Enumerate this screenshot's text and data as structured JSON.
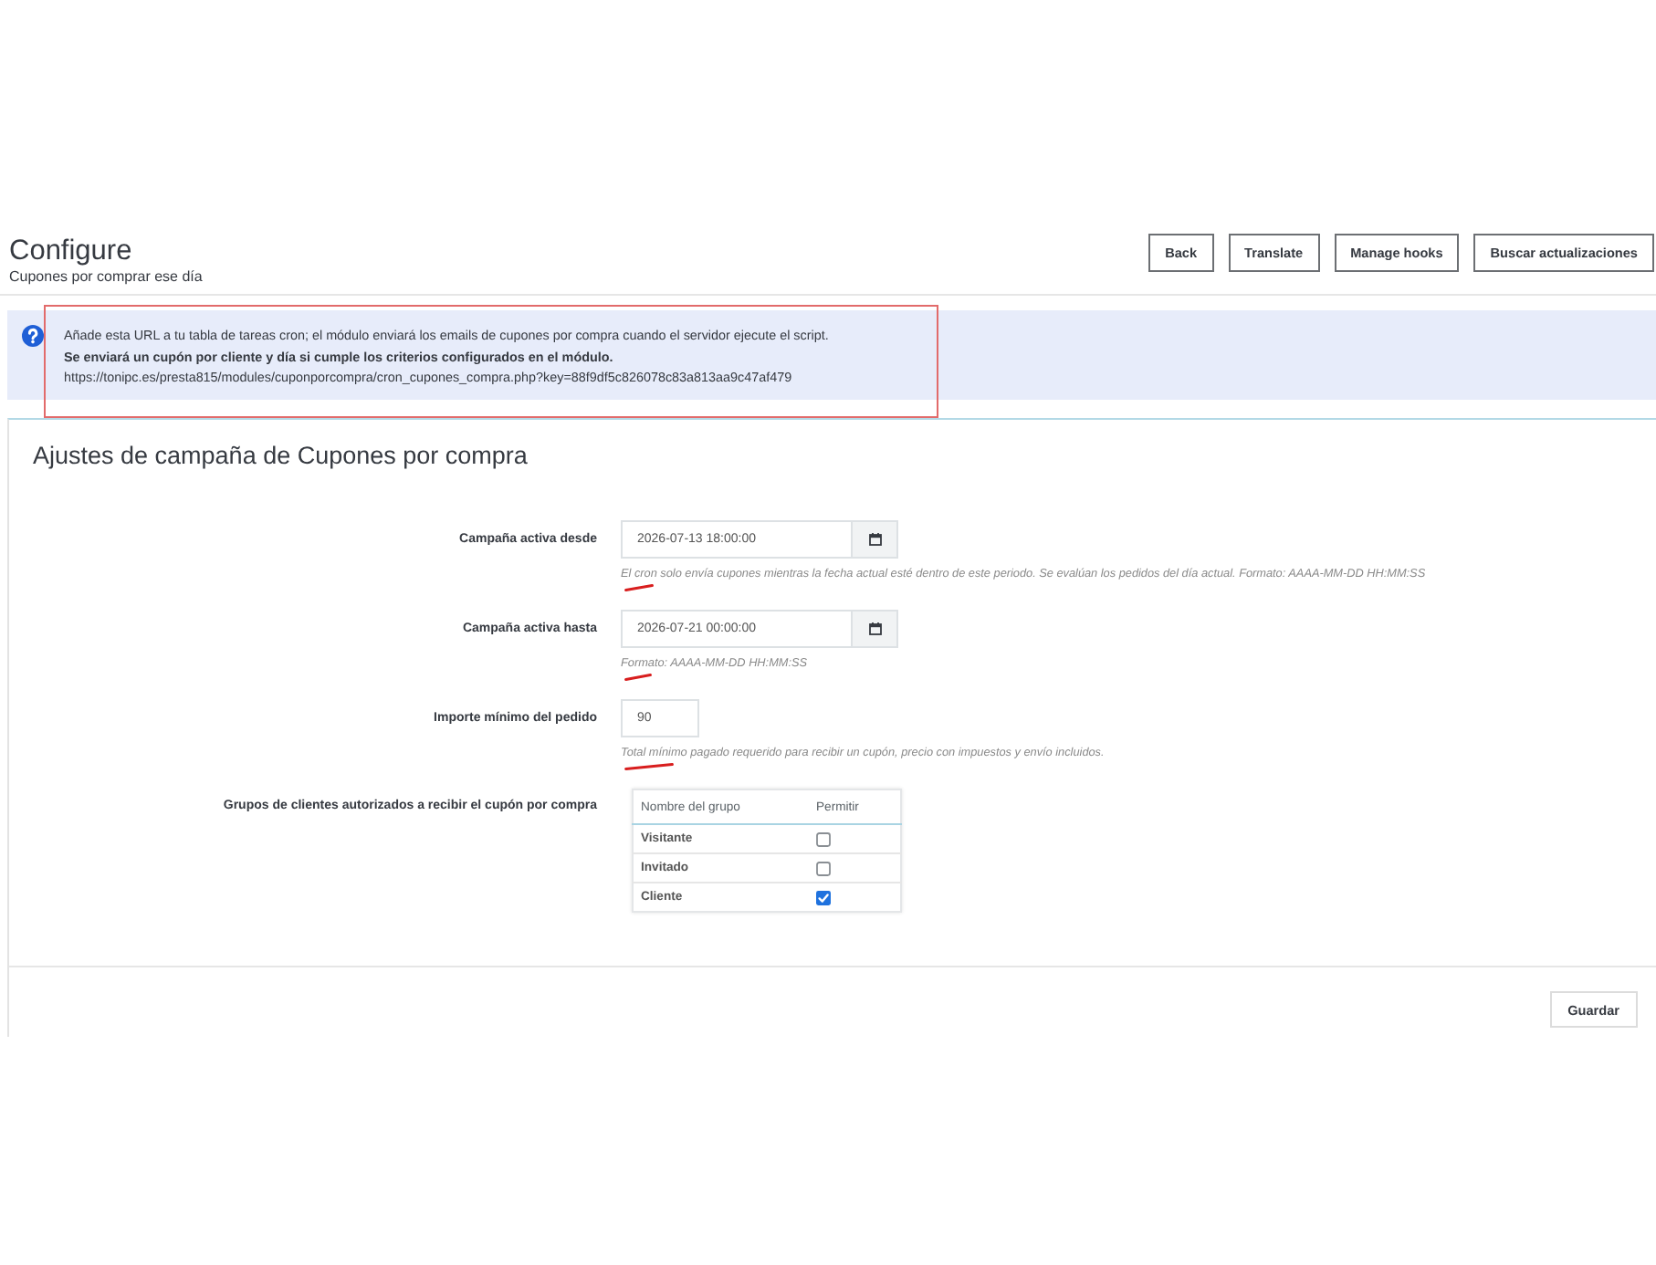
{
  "header": {
    "title": "Configure",
    "subtitle": "Cupones por comprar ese día",
    "buttons": [
      "Back",
      "Translate",
      "Manage hooks",
      "Buscar actualizaciones"
    ]
  },
  "alert": {
    "annotated": true,
    "lines": [
      {
        "kind": "text",
        "text": "Añade esta URL a tu tabla de tareas cron; el módulo enviará los emails de cupones por compra cuando el servidor ejecute el script."
      },
      {
        "kind": "emphasis",
        "text": "Se enviará un cupón por cliente y día si cumple los criterios configurados en el módulo."
      },
      {
        "kind": "url",
        "text": "https://tonipc.es/presta815/modules/cuponporcompra/cron_cupones_compra.php?key=88f9df5c826078c83a813aa9c47af479"
      }
    ]
  },
  "panel": {
    "title": "Ajustes de campaña de Cupones por compra",
    "fields": [
      {
        "kind": "datetime",
        "label": "Campaña activa desde",
        "value": "2026-07-13 18:00:00",
        "help": "El cron solo envía cupones mientras la fecha actual esté dentro de este periodo. Se evalúan los pedidos del día actual. Formato: AAAA-MM-DD HH:MM:SS",
        "annotated": true
      },
      {
        "kind": "datetime",
        "label": "Campaña activa hasta",
        "value": "2026-07-21 00:00:00",
        "help": "Formato: AAAA-MM-DD HH:MM:SS",
        "annotated": true
      },
      {
        "kind": "number",
        "label": "Importe mínimo del pedido",
        "value": "90",
        "help": "Total mínimo pagado requerido para recibir un cupón, precio con impuestos y envío incluidos.",
        "annotated": true
      },
      {
        "kind": "groups",
        "label": "Grupos de clientes autorizados a recibir el cupón por compra",
        "columns": [
          "Nombre del grupo",
          "Permitir"
        ],
        "rows": [
          {
            "name": "Visitante",
            "checked": false
          },
          {
            "name": "Invitado",
            "checked": false
          },
          {
            "name": "Cliente",
            "checked": true
          }
        ]
      }
    ],
    "save_button": "Guardar"
  }
}
